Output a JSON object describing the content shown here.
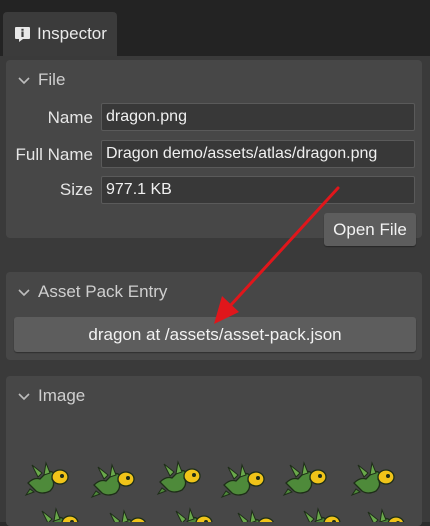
{
  "tab": {
    "label": "Inspector",
    "icon": "info-icon"
  },
  "file_section": {
    "title": "File",
    "name_label": "Name",
    "name_value": "dragon.png",
    "fullname_label": "Full Name",
    "fullname_value": "Dragon demo/assets/atlas/dragon.png",
    "size_label": "Size",
    "size_value": "977.1 KB",
    "open_button": "Open File"
  },
  "asset_section": {
    "title": "Asset Pack Entry",
    "entry_button": "dragon at /assets/asset-pack.json"
  },
  "image_section": {
    "title": "Image"
  },
  "colors": {
    "panel": "#474747",
    "background": "#3a3a3a",
    "button": "#5d5d5d",
    "arrow": "#e0161b",
    "dragon_body": "#4e8a3a"
  }
}
